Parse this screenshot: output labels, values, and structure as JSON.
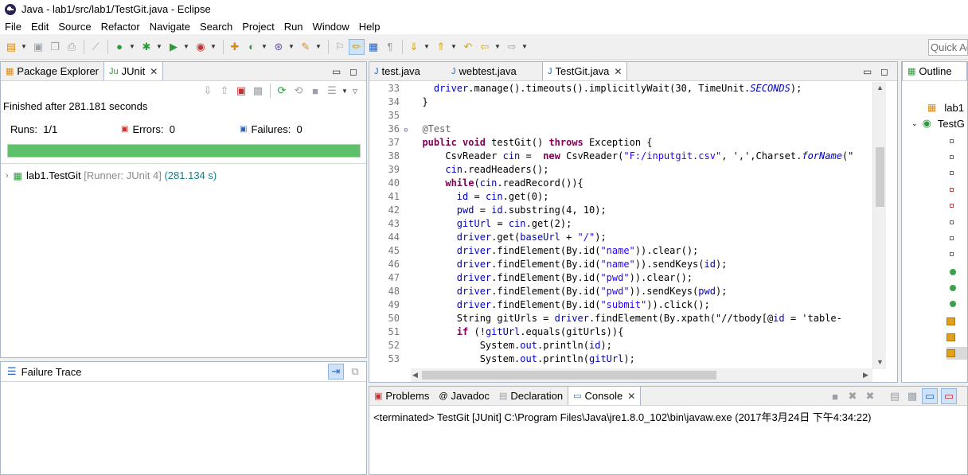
{
  "window": {
    "title": "Java - lab1/src/lab1/TestGit.java - Eclipse"
  },
  "menu": [
    "File",
    "Edit",
    "Source",
    "Refactor",
    "Navigate",
    "Search",
    "Project",
    "Run",
    "Window",
    "Help"
  ],
  "quick_access": {
    "placeholder": "Quick Access"
  },
  "junit": {
    "tabs": [
      {
        "label": "Package Explorer",
        "active": false
      },
      {
        "label": "JUnit",
        "active": true
      }
    ],
    "finished": "Finished after 281.181 seconds",
    "runs_label": "Runs:",
    "runs_value": "1/1",
    "errors_label": "Errors:",
    "errors_value": "0",
    "failures_label": "Failures:",
    "failures_value": "0",
    "progress_fraction": 1.0,
    "progress_color": "#5ec06a",
    "test": {
      "name": "lab1.TestGit",
      "runner": "[Runner: JUnit 4]",
      "time": "(281.134 s)"
    },
    "failure_trace_label": "Failure Trace"
  },
  "editor": {
    "tabs": [
      {
        "label": "test.java",
        "active": false
      },
      {
        "label": "webtest.java",
        "active": false
      },
      {
        "label": "TestGit.java",
        "active": true
      }
    ],
    "code_lines": [
      {
        "n": "33",
        "fold": "",
        "code": "  driver.manage().timeouts().implicitlyWait(30, TimeUnit.SECONDS);"
      },
      {
        "n": "34",
        "fold": "",
        "code": "}"
      },
      {
        "n": "35",
        "fold": "",
        "code": ""
      },
      {
        "n": "36",
        "fold": "⊖",
        "code": "@Test"
      },
      {
        "n": "37",
        "fold": "",
        "code": "public void testGit() throws Exception {"
      },
      {
        "n": "38",
        "fold": "",
        "code": "    CsvReader cin =  new CsvReader(\"F:/inputgit.csv\", ',',Charset.forName(\""
      },
      {
        "n": "39",
        "fold": "",
        "code": "    cin.readHeaders();"
      },
      {
        "n": "40",
        "fold": "",
        "code": "    while(cin.readRecord()){"
      },
      {
        "n": "41",
        "fold": "",
        "code": "      id = cin.get(0);"
      },
      {
        "n": "42",
        "fold": "",
        "code": "      pwd = id.substring(4, 10);"
      },
      {
        "n": "43",
        "fold": "",
        "code": "      gitUrl = cin.get(2);"
      },
      {
        "n": "44",
        "fold": "",
        "code": "      driver.get(baseUrl + \"/\");"
      },
      {
        "n": "45",
        "fold": "",
        "code": "      driver.findElement(By.id(\"name\")).clear();"
      },
      {
        "n": "46",
        "fold": "",
        "code": "      driver.findElement(By.id(\"name\")).sendKeys(id);"
      },
      {
        "n": "47",
        "fold": "",
        "code": "      driver.findElement(By.id(\"pwd\")).clear();"
      },
      {
        "n": "48",
        "fold": "",
        "code": "      driver.findElement(By.id(\"pwd\")).sendKeys(pwd);"
      },
      {
        "n": "49",
        "fold": "",
        "code": "      driver.findElement(By.id(\"submit\")).click();"
      },
      {
        "n": "50",
        "fold": "",
        "code": "      String gitUrls = driver.findElement(By.xpath(\"//tbody[@id = 'table-"
      },
      {
        "n": "51",
        "fold": "",
        "code": "      if (!gitUrl.equals(gitUrls)){"
      },
      {
        "n": "52",
        "fold": "",
        "code": "          System.out.println(id);"
      },
      {
        "n": "53",
        "fold": "",
        "code": "          System.out.println(gitUrl);"
      }
    ]
  },
  "console": {
    "tabs": [
      {
        "label": "Problems",
        "active": false
      },
      {
        "label": "Javadoc",
        "active": false
      },
      {
        "label": "Declaration",
        "active": false
      },
      {
        "label": "Console",
        "active": true
      }
    ],
    "status": "<terminated> TestGit [JUnit] C:\\Program Files\\Java\\jre1.8.0_102\\bin\\javaw.exe (2017年3月24日 下午4:34:22)"
  },
  "outline": {
    "tab": "Outline",
    "items": [
      "lab1",
      "TestG"
    ]
  }
}
